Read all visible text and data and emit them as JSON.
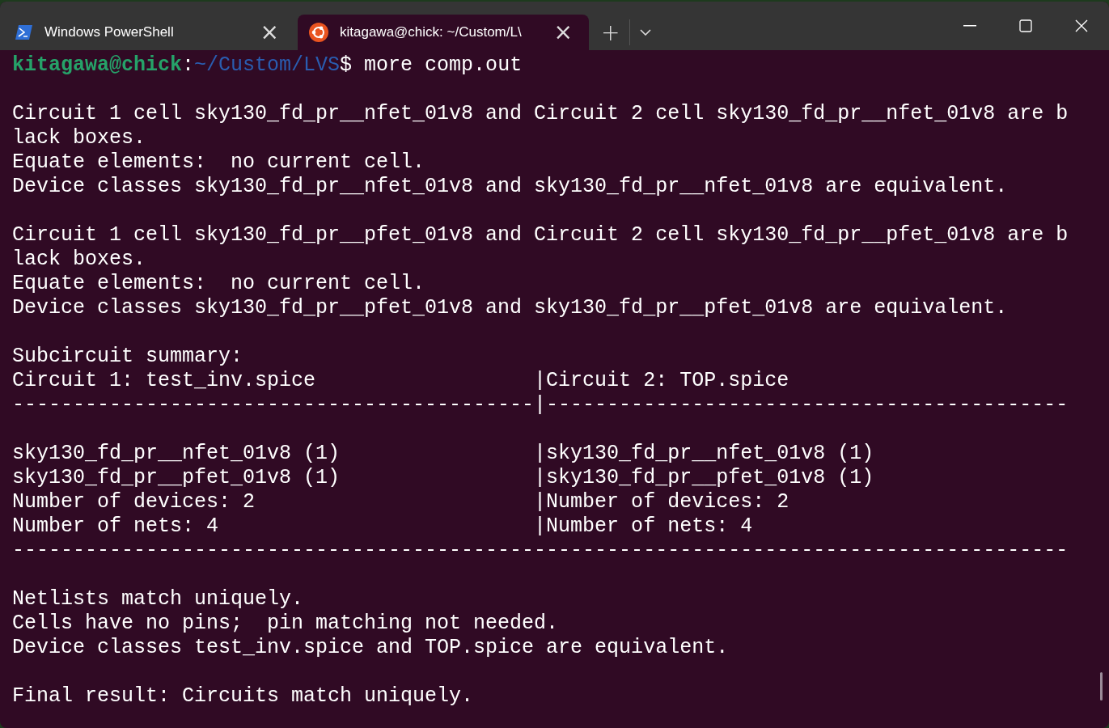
{
  "tabs": [
    {
      "kind": "powershell",
      "title": "Windows PowerShell",
      "close": "×",
      "selected": false
    },
    {
      "kind": "ubuntu",
      "title": "kitagawa@chick: ~/Custom/L\\",
      "close": "×",
      "selected": true
    }
  ],
  "new_tab": "+",
  "prompt": {
    "user_host": "kitagawa@chick",
    "separator": ":",
    "path": "~/Custom/LVS",
    "command": "$ more comp.out"
  },
  "output_blocks": [
    [
      "Circuit 1 cell sky130_fd_pr__nfet_01v8 and Circuit 2 cell sky130_fd_pr__nfet_01v8 are b",
      "lack boxes.",
      "Equate elements:  no current cell.",
      "Device classes sky130_fd_pr__nfet_01v8 and sky130_fd_pr__nfet_01v8 are equivalent."
    ],
    [
      "Circuit 1 cell sky130_fd_pr__pfet_01v8 and Circuit 2 cell sky130_fd_pr__pfet_01v8 are b",
      "lack boxes.",
      "Equate elements:  no current cell.",
      "Device classes sky130_fd_pr__pfet_01v8 and sky130_fd_pr__pfet_01v8 are equivalent."
    ],
    [
      "Subcircuit summary:",
      "Circuit 1: test_inv.spice                  |Circuit 2: TOP.spice",
      "-------------------------------------------|-------------------------------------------"
    ],
    [
      "sky130_fd_pr__nfet_01v8 (1)                |sky130_fd_pr__nfet_01v8 (1)",
      "sky130_fd_pr__pfet_01v8 (1)                |sky130_fd_pr__pfet_01v8 (1)",
      "Number of devices: 2                       |Number of devices: 2",
      "Number of nets: 4                          |Number of nets: 4",
      "---------------------------------------------------------------------------------------"
    ],
    [
      "Netlists match uniquely.",
      "Cells have no pins;  pin matching not needed.",
      "Device classes test_inv.spice and TOP.spice are equivalent."
    ],
    [
      "Final result: Circuits match uniquely."
    ]
  ]
}
